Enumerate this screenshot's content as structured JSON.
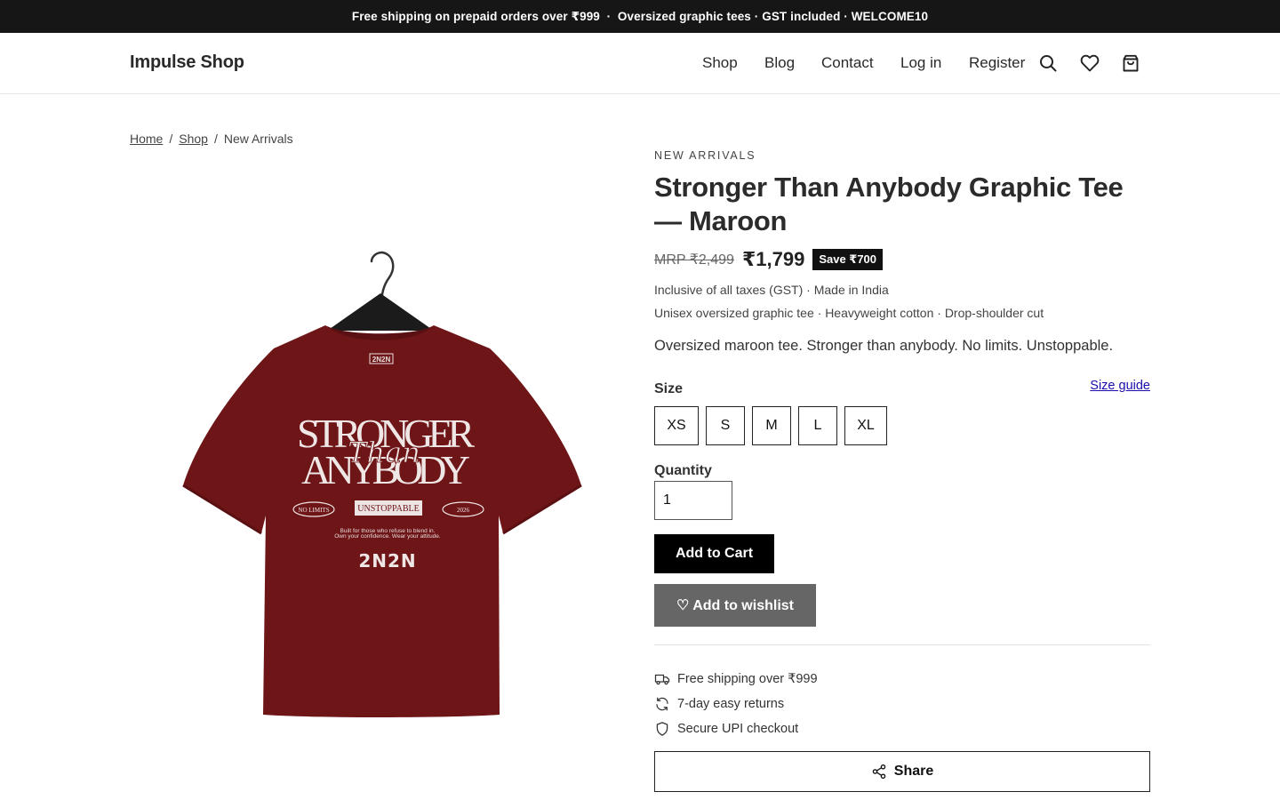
{
  "announcement": {
    "text": "Free shipping on prepaid orders over ₹999  ·  Oversized graphic tees · GST included · WELCOME10"
  },
  "header": {
    "logo": "Impulse Shop",
    "nav": [
      "Shop",
      "Blog",
      "Contact",
      "Log in",
      "Register"
    ],
    "icons": [
      "search-icon",
      "heart-icon",
      "cart-icon"
    ]
  },
  "breadcrumb": {
    "home": "Home",
    "shop": "Shop",
    "current": "New Arrivals",
    "separator": "/"
  },
  "product": {
    "collection": "NEW ARRIVALS",
    "title": "Stronger Than Anybody Graphic Tee — Maroon",
    "mrp": "MRP ₹2,499",
    "price": "₹1,799",
    "save_badge": "Save ₹700",
    "tax_note": "Inclusive of all taxes (GST) · Made in India",
    "type_note": "Unisex oversized graphic tee · Heavyweight cotton · Drop-shoulder cut",
    "description": "Oversized maroon tee. Stronger than anybody. No limits. Unstoppable.",
    "size_label": "Size",
    "size_guide": "Size guide",
    "sizes": [
      "XS",
      "S",
      "M",
      "L",
      "XL"
    ],
    "quantity_label": "Quantity",
    "quantity_value": "1",
    "add_to_cart": "Add to Cart",
    "add_to_wishlist": "♡ Add to wishlist",
    "perks": [
      {
        "icon": "truck-icon",
        "text": "Free shipping over ₹999"
      },
      {
        "icon": "refresh-icon",
        "text": "7-day easy returns"
      },
      {
        "icon": "shield-icon",
        "text": "Secure UPI checkout"
      }
    ],
    "share": "Share"
  },
  "tee_print": {
    "neck_label": "2N2N",
    "line1": "STRONGER",
    "script": "Than",
    "line2": "ANYBODY",
    "pill_left": "NO LIMITS",
    "pill_center": "UNSTOPPABLE",
    "pill_right": "2026",
    "tagline1": "Built for those who refuse to blend in.",
    "tagline2": "Own your confidence. Wear your attitude.",
    "brand_mark": "2N2N"
  },
  "colors": {
    "announcement_bg": "#161616",
    "tee_maroon": "#6e1517",
    "wishlist_bg": "#666666",
    "link_blue": "#1a0dab"
  }
}
